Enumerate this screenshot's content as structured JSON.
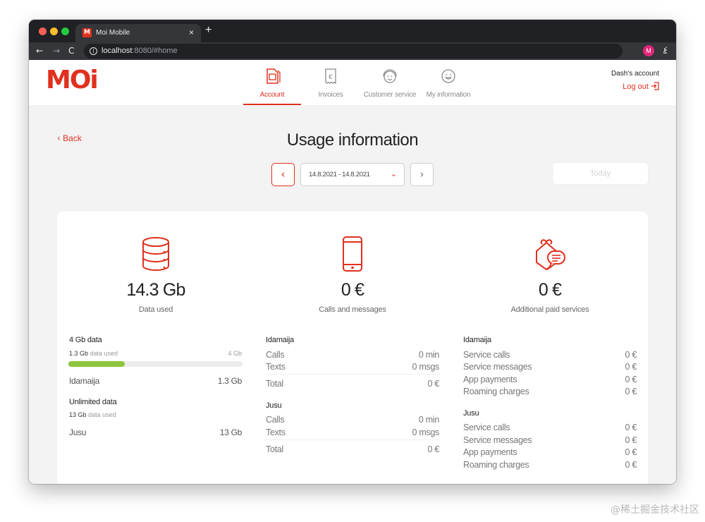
{
  "browser": {
    "tab_title": "Moi Mobile",
    "tab_favicon": "M",
    "tab_close": "×",
    "new_tab": "+",
    "url_host": "localhost",
    "url_rest": ":8080/#home",
    "profile_initial": "M"
  },
  "header": {
    "logo": "MOi",
    "account_name": "Dash's account",
    "logout_label": "Log out",
    "nav": [
      {
        "label": "Account",
        "icon": "sim-card-icon",
        "active": true
      },
      {
        "label": "Invoices",
        "icon": "invoice-icon",
        "active": false
      },
      {
        "label": "Customer service",
        "icon": "customer-service-icon",
        "active": false
      },
      {
        "label": "My information",
        "icon": "smiley-icon",
        "active": false
      }
    ]
  },
  "usage": {
    "back_label": "Back",
    "title": "Usage information",
    "date_range": "14.8.2021 - 14.8.2021",
    "today_label": "Today"
  },
  "data_col": {
    "icon": "database-icon",
    "value": "14.3 Gb",
    "label": "Data used",
    "limited": {
      "title": "4 Gb data",
      "used_value": "1.3 Gb",
      "used_suffix": "data used",
      "cap": "4 Gb",
      "progress_fraction": 0.325,
      "rows": [
        {
          "label": "Idamaija",
          "value": "1.3 Gb"
        }
      ]
    },
    "unlimited": {
      "title": "Unlimited data",
      "used_value": "13 Gb",
      "used_suffix": "data used",
      "rows": [
        {
          "label": "Jusu",
          "value": "13 Gb"
        }
      ]
    }
  },
  "calls_col": {
    "icon": "mobile-phone-icon",
    "value": "0 €",
    "label": "Calls and messages",
    "groups": [
      {
        "name": "Idamaija",
        "rows": [
          {
            "label": "Calls",
            "value": "0 min"
          },
          {
            "label": "Texts",
            "value": "0 msgs"
          }
        ],
        "total_label": "Total",
        "total_value": "0 €"
      },
      {
        "name": "Jusu",
        "rows": [
          {
            "label": "Calls",
            "value": "0 min"
          },
          {
            "label": "Texts",
            "value": "0 msgs"
          }
        ],
        "total_label": "Total",
        "total_value": "0 €"
      }
    ]
  },
  "paid_col": {
    "icon": "gift-message-icon",
    "value": "0 €",
    "label": "Additional paid services",
    "groups": [
      {
        "name": "Idamaija",
        "rows": [
          {
            "label": "Service calls",
            "value": "0 €"
          },
          {
            "label": "Service messages",
            "value": "0 €"
          },
          {
            "label": "App payments",
            "value": "0 €"
          },
          {
            "label": "Roaming charges",
            "value": "0 €"
          }
        ]
      },
      {
        "name": "Jusu",
        "rows": [
          {
            "label": "Service calls",
            "value": "0 €"
          },
          {
            "label": "Service messages",
            "value": "0 €"
          },
          {
            "label": "App payments",
            "value": "0 €"
          },
          {
            "label": "Roaming charges",
            "value": "0 €"
          }
        ]
      }
    ]
  },
  "colors": {
    "brand": "#e0301e",
    "progress": "#8cc63f"
  },
  "watermark": "@稀土掘金技术社区"
}
